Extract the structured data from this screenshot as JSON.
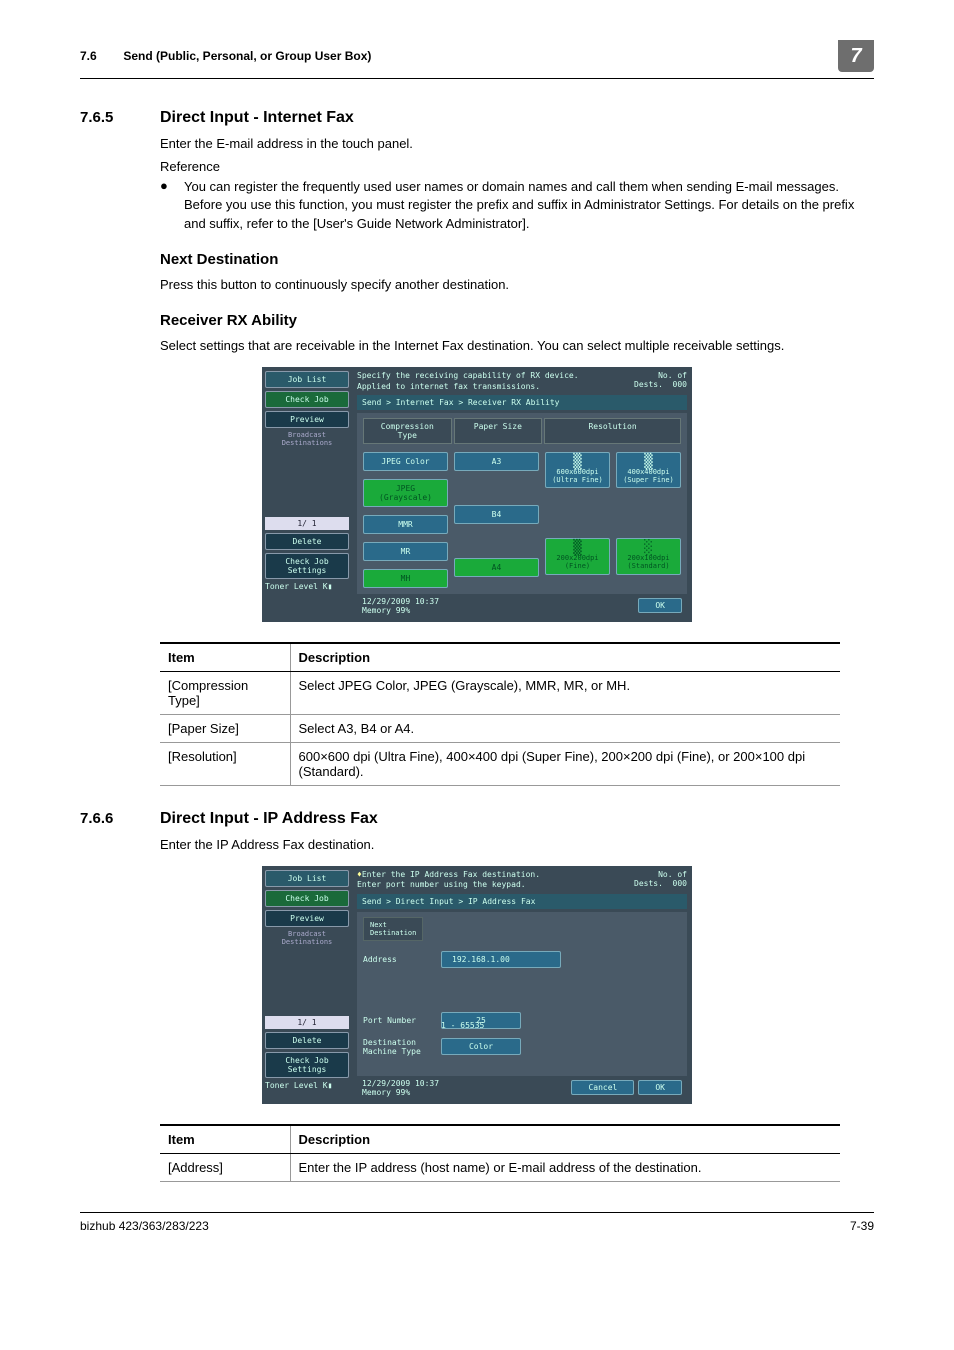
{
  "header": {
    "section_num": "7.6",
    "section_title": "Send (Public, Personal, or Group User Box)",
    "chapter": "7"
  },
  "s765": {
    "num": "7.6.5",
    "title": "Direct Input - Internet Fax",
    "para1": "Enter the E-mail address in the touch panel.",
    "ref_label": "Reference",
    "bullet1": "You can register the frequently used user names or domain names and call them when sending E-mail messages. Before you use this function, you must register the prefix and suffix in Administrator Settings. For details on the prefix and suffix, refer to the [User's Guide Network Administrator].",
    "nextdest_h": "Next Destination",
    "nextdest_p": "Press this button to continuously specify another destination.",
    "rxab_h": "Receiver RX Ability",
    "rxab_p": "Select settings that are receivable in the Internet Fax destination. You can select multiple receivable settings."
  },
  "screenshot1": {
    "joblist": "Job List",
    "checkjob": "Check Job",
    "preview": "Preview",
    "broadcast": "Broadcast\nDestinations",
    "pager": "1/  1",
    "delete": "Delete",
    "checkset": "Check Job\nSettings",
    "toner": "Toner Level",
    "prompt": "Specify the receiving capability of RX device.\nApplied to internet fax transmissions.",
    "dests_l": "No. of\nDests.",
    "dests_v": "000",
    "breadcrumb": "Send > Internet Fax > Receiver RX Ability",
    "tabs": [
      "Compression\nType",
      "Paper Size",
      "Resolution"
    ],
    "comp": [
      "JPEG Color",
      "JPEG\n(Grayscale)",
      "MMR",
      "MR",
      "MH"
    ],
    "paper": [
      "A3",
      "",
      "B4",
      "",
      "A4"
    ],
    "res": [
      {
        "l": "600x600dpi\n(Ultra Fine)"
      },
      {
        "l": "400x400dpi\n(Super Fine)"
      },
      {
        "l": "200x200dpi\n(Fine)"
      },
      {
        "l": "200x100dpi\n(Standard)"
      }
    ],
    "datetime": "12/29/2009   10:37",
    "memory": "Memory        99%",
    "ok": "OK"
  },
  "table1": {
    "h1": "Item",
    "h2": "Description",
    "rows": [
      {
        "i": "[Compression Type]",
        "d": "Select JPEG Color, JPEG (Grayscale), MMR, MR, or MH."
      },
      {
        "i": "[Paper Size]",
        "d": "Select A3, B4 or A4."
      },
      {
        "i": "[Resolution]",
        "d": "600×600 dpi (Ultra Fine), 400×400 dpi (Super Fine), 200×200 dpi (Fine), or 200×100 dpi (Standard)."
      }
    ]
  },
  "s766": {
    "num": "7.6.6",
    "title": "Direct Input - IP Address Fax",
    "para1": "Enter the IP Address Fax destination."
  },
  "screenshot2": {
    "joblist": "Job List",
    "checkjob": "Check Job",
    "preview": "Preview",
    "broadcast": "Broadcast\nDestinations",
    "pager": "1/  1",
    "delete": "Delete",
    "checkset": "Check Job\nSettings",
    "toner": "Toner Level",
    "prompt": "Enter the IP Address Fax destination.\nEnter port number using the keypad.",
    "dests_l": "No. of\nDests.",
    "dests_v": "000",
    "breadcrumb": "Send > Direct Input > IP Address Fax",
    "next": "Next\nDestination",
    "addr_l": "Address",
    "addr_v": "192.168.1.00",
    "port_l": "Port Number",
    "port_v": "25",
    "port_r": "1   -   65535",
    "mtype_l": "Destination\nMachine Type",
    "mtype_v": "Color",
    "datetime": "12/29/2009   10:37",
    "memory": "Memory        99%",
    "cancel": "Cancel",
    "ok": "OK"
  },
  "table2": {
    "h1": "Item",
    "h2": "Description",
    "rows": [
      {
        "i": "[Address]",
        "d": "Enter the IP address (host name) or E-mail address of the destination."
      }
    ]
  },
  "footer": {
    "model": "bizhub 423/363/283/223",
    "page": "7-39"
  },
  "chart_data": null
}
